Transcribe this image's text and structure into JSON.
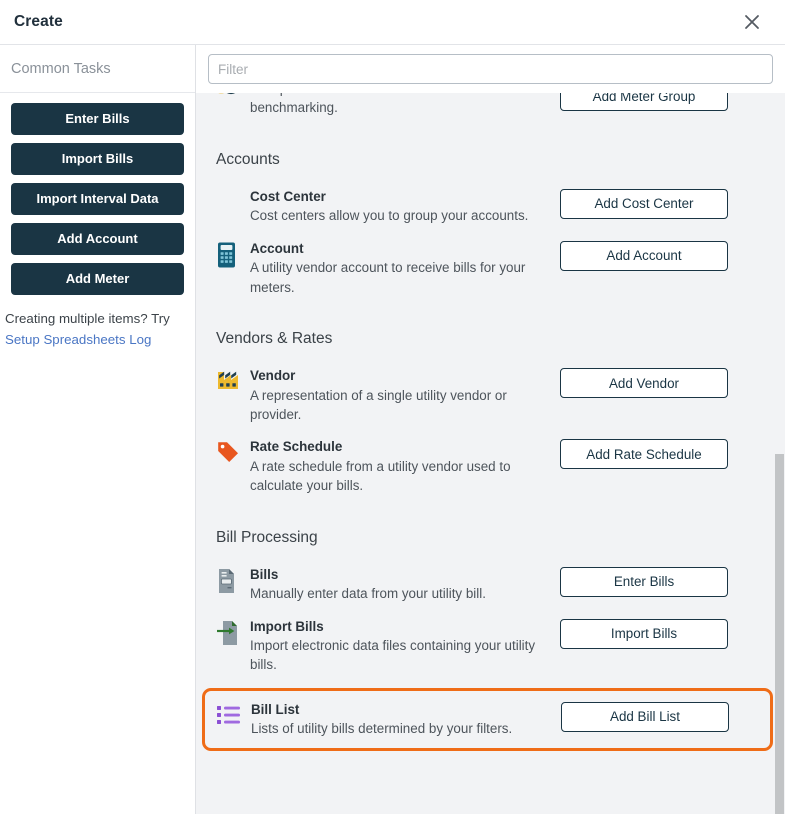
{
  "dialog": {
    "title": "Create",
    "close_icon": "close-icon"
  },
  "sidebar": {
    "heading": "Common Tasks",
    "buttons": [
      {
        "label": "Enter Bills"
      },
      {
        "label": "Import Bills"
      },
      {
        "label": "Import Interval Data"
      },
      {
        "label": "Add Account"
      },
      {
        "label": "Add Meter"
      }
    ],
    "note_text": "Creating multiple items? Try",
    "note_link": "Setup Spreadsheets Log"
  },
  "filter": {
    "placeholder": "Filter",
    "value": ""
  },
  "sections": [
    {
      "id": "meters-partial",
      "title": "",
      "rows": [
        {
          "icon": "meter-group-icon",
          "name": "",
          "desc": "Group meters that share characteristics for benchmarking.",
          "button": "Add Meter Group",
          "highlighted": false
        }
      ]
    },
    {
      "id": "accounts",
      "title": "Accounts",
      "rows": [
        {
          "icon": "cost-center-icon",
          "name": "Cost Center",
          "desc": "Cost centers allow you to group your accounts.",
          "button": "Add Cost Center",
          "highlighted": false
        },
        {
          "icon": "calculator-icon",
          "name": "Account",
          "desc": "A utility vendor account to receive bills for your meters.",
          "button": "Add Account",
          "highlighted": false
        }
      ]
    },
    {
      "id": "vendors-rates",
      "title": "Vendors & Rates",
      "rows": [
        {
          "icon": "factory-icon",
          "name": "Vendor",
          "desc": "A representation of a single utility vendor or provider.",
          "button": "Add Vendor",
          "highlighted": false
        },
        {
          "icon": "tag-icon",
          "name": "Rate Schedule",
          "desc": "A rate schedule from a utility vendor used to calculate your bills.",
          "button": "Add Rate Schedule",
          "highlighted": false
        }
      ]
    },
    {
      "id": "bill-processing",
      "title": "Bill Processing",
      "rows": [
        {
          "icon": "document-icon",
          "name": "Bills",
          "desc": "Manually enter data from your utility bill.",
          "button": "Enter Bills",
          "highlighted": false
        },
        {
          "icon": "import-document-icon",
          "name": "Import Bills",
          "desc": "Import electronic data files containing your utility bills.",
          "button": "Import Bills",
          "highlighted": false
        },
        {
          "icon": "list-icon",
          "name": "Bill List",
          "desc": "Lists of utility bills determined by your filters.",
          "button": "Add Bill List",
          "highlighted": true
        }
      ]
    }
  ],
  "colors": {
    "navy": "#1a3544",
    "highlight_orange": "#ef6c17",
    "link_blue": "#4a76c4",
    "panel_bg": "#f2f3f5",
    "icon_yellow": "#edb92e",
    "icon_orange": "#e8561f",
    "icon_teal": "#14607b",
    "icon_gray": "#8d9aa3",
    "icon_green": "#2f7a2f",
    "icon_purple": "#8b4fd4"
  },
  "scrollbar": {
    "thumb_top_pct": 50,
    "thumb_height_pct": 50
  }
}
